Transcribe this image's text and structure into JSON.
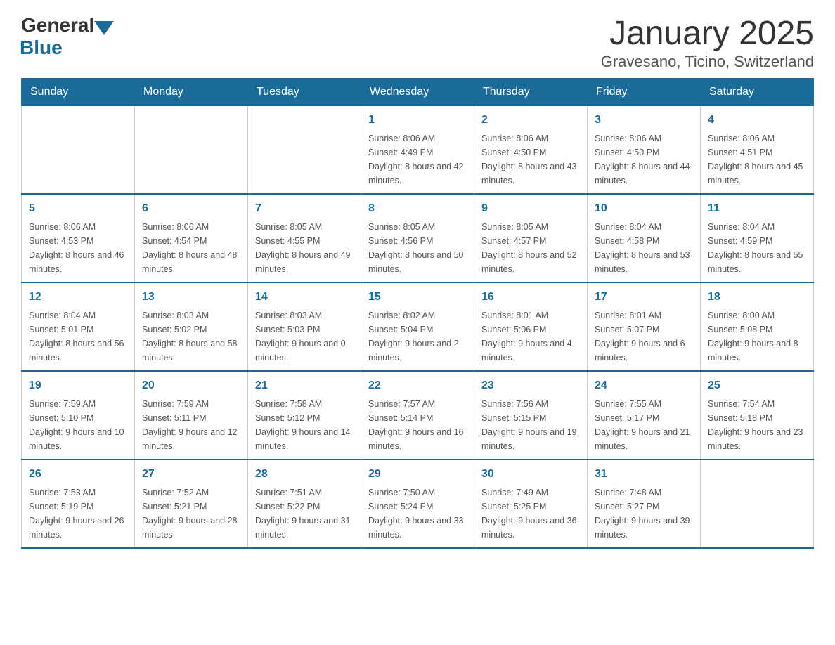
{
  "logo": {
    "text_general": "General",
    "text_blue": "Blue"
  },
  "title": "January 2025",
  "subtitle": "Gravesano, Ticino, Switzerland",
  "weekdays": [
    "Sunday",
    "Monday",
    "Tuesday",
    "Wednesday",
    "Thursday",
    "Friday",
    "Saturday"
  ],
  "weeks": [
    [
      {
        "day": "",
        "info": ""
      },
      {
        "day": "",
        "info": ""
      },
      {
        "day": "",
        "info": ""
      },
      {
        "day": "1",
        "info": "Sunrise: 8:06 AM\nSunset: 4:49 PM\nDaylight: 8 hours\nand 42 minutes."
      },
      {
        "day": "2",
        "info": "Sunrise: 8:06 AM\nSunset: 4:50 PM\nDaylight: 8 hours\nand 43 minutes."
      },
      {
        "day": "3",
        "info": "Sunrise: 8:06 AM\nSunset: 4:50 PM\nDaylight: 8 hours\nand 44 minutes."
      },
      {
        "day": "4",
        "info": "Sunrise: 8:06 AM\nSunset: 4:51 PM\nDaylight: 8 hours\nand 45 minutes."
      }
    ],
    [
      {
        "day": "5",
        "info": "Sunrise: 8:06 AM\nSunset: 4:53 PM\nDaylight: 8 hours\nand 46 minutes."
      },
      {
        "day": "6",
        "info": "Sunrise: 8:06 AM\nSunset: 4:54 PM\nDaylight: 8 hours\nand 48 minutes."
      },
      {
        "day": "7",
        "info": "Sunrise: 8:05 AM\nSunset: 4:55 PM\nDaylight: 8 hours\nand 49 minutes."
      },
      {
        "day": "8",
        "info": "Sunrise: 8:05 AM\nSunset: 4:56 PM\nDaylight: 8 hours\nand 50 minutes."
      },
      {
        "day": "9",
        "info": "Sunrise: 8:05 AM\nSunset: 4:57 PM\nDaylight: 8 hours\nand 52 minutes."
      },
      {
        "day": "10",
        "info": "Sunrise: 8:04 AM\nSunset: 4:58 PM\nDaylight: 8 hours\nand 53 minutes."
      },
      {
        "day": "11",
        "info": "Sunrise: 8:04 AM\nSunset: 4:59 PM\nDaylight: 8 hours\nand 55 minutes."
      }
    ],
    [
      {
        "day": "12",
        "info": "Sunrise: 8:04 AM\nSunset: 5:01 PM\nDaylight: 8 hours\nand 56 minutes."
      },
      {
        "day": "13",
        "info": "Sunrise: 8:03 AM\nSunset: 5:02 PM\nDaylight: 8 hours\nand 58 minutes."
      },
      {
        "day": "14",
        "info": "Sunrise: 8:03 AM\nSunset: 5:03 PM\nDaylight: 9 hours\nand 0 minutes."
      },
      {
        "day": "15",
        "info": "Sunrise: 8:02 AM\nSunset: 5:04 PM\nDaylight: 9 hours\nand 2 minutes."
      },
      {
        "day": "16",
        "info": "Sunrise: 8:01 AM\nSunset: 5:06 PM\nDaylight: 9 hours\nand 4 minutes."
      },
      {
        "day": "17",
        "info": "Sunrise: 8:01 AM\nSunset: 5:07 PM\nDaylight: 9 hours\nand 6 minutes."
      },
      {
        "day": "18",
        "info": "Sunrise: 8:00 AM\nSunset: 5:08 PM\nDaylight: 9 hours\nand 8 minutes."
      }
    ],
    [
      {
        "day": "19",
        "info": "Sunrise: 7:59 AM\nSunset: 5:10 PM\nDaylight: 9 hours\nand 10 minutes."
      },
      {
        "day": "20",
        "info": "Sunrise: 7:59 AM\nSunset: 5:11 PM\nDaylight: 9 hours\nand 12 minutes."
      },
      {
        "day": "21",
        "info": "Sunrise: 7:58 AM\nSunset: 5:12 PM\nDaylight: 9 hours\nand 14 minutes."
      },
      {
        "day": "22",
        "info": "Sunrise: 7:57 AM\nSunset: 5:14 PM\nDaylight: 9 hours\nand 16 minutes."
      },
      {
        "day": "23",
        "info": "Sunrise: 7:56 AM\nSunset: 5:15 PM\nDaylight: 9 hours\nand 19 minutes."
      },
      {
        "day": "24",
        "info": "Sunrise: 7:55 AM\nSunset: 5:17 PM\nDaylight: 9 hours\nand 21 minutes."
      },
      {
        "day": "25",
        "info": "Sunrise: 7:54 AM\nSunset: 5:18 PM\nDaylight: 9 hours\nand 23 minutes."
      }
    ],
    [
      {
        "day": "26",
        "info": "Sunrise: 7:53 AM\nSunset: 5:19 PM\nDaylight: 9 hours\nand 26 minutes."
      },
      {
        "day": "27",
        "info": "Sunrise: 7:52 AM\nSunset: 5:21 PM\nDaylight: 9 hours\nand 28 minutes."
      },
      {
        "day": "28",
        "info": "Sunrise: 7:51 AM\nSunset: 5:22 PM\nDaylight: 9 hours\nand 31 minutes."
      },
      {
        "day": "29",
        "info": "Sunrise: 7:50 AM\nSunset: 5:24 PM\nDaylight: 9 hours\nand 33 minutes."
      },
      {
        "day": "30",
        "info": "Sunrise: 7:49 AM\nSunset: 5:25 PM\nDaylight: 9 hours\nand 36 minutes."
      },
      {
        "day": "31",
        "info": "Sunrise: 7:48 AM\nSunset: 5:27 PM\nDaylight: 9 hours\nand 39 minutes."
      },
      {
        "day": "",
        "info": ""
      }
    ]
  ]
}
